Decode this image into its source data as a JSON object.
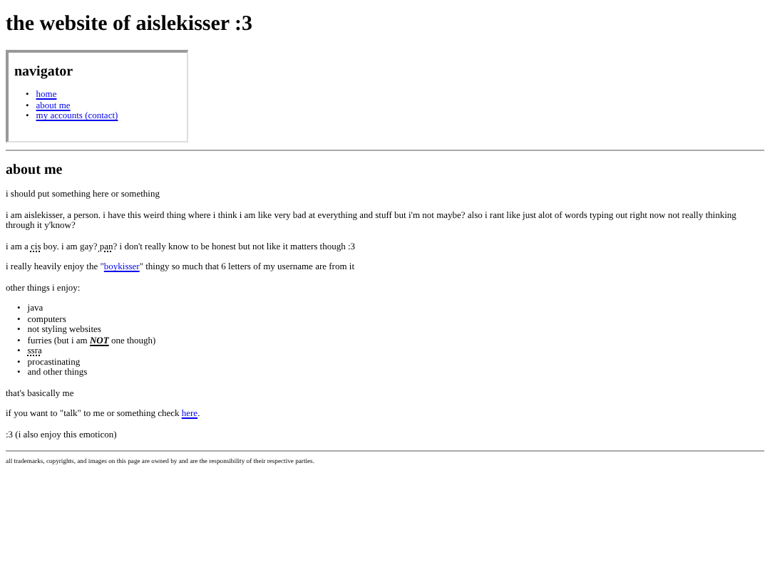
{
  "title": "the website of aislekisser :3",
  "navigator": {
    "heading": "navigator",
    "bullet": "•",
    "links": [
      "home",
      "about me",
      "my accounts (contact)"
    ]
  },
  "about": {
    "heading": "about me",
    "bullet": "•",
    "paragraphs": [
      [
        {
          "kind": "text",
          "text": "i should put something here or something"
        }
      ],
      [
        {
          "kind": "text",
          "text": "i am aislekisser, a person. i have this weird thing where i think i am like very bad at everything and stuff but i'm not maybe? also i rant like just alot of words typing out right now not really thinking through it y'know?"
        }
      ],
      [
        {
          "kind": "text",
          "text": "i am a "
        },
        {
          "kind": "abbr",
          "text": "cis"
        },
        {
          "kind": "text",
          "text": " boy. i am gay? "
        },
        {
          "kind": "abbr",
          "text": "pan"
        },
        {
          "kind": "text",
          "text": "? i don't really know to be honest but not like it matters though :3"
        }
      ],
      [
        {
          "kind": "text",
          "text": "i really heavily enjoy the \""
        },
        {
          "kind": "link",
          "text": "boykisser"
        },
        {
          "kind": "text",
          "text": "\" thingy so much that 6 letters of my username are from it"
        }
      ],
      [
        {
          "kind": "text",
          "text": "other things i enjoy:"
        }
      ]
    ],
    "enjoy": [
      [
        {
          "kind": "text",
          "text": "java"
        }
      ],
      [
        {
          "kind": "text",
          "text": "computers"
        }
      ],
      [
        {
          "kind": "text",
          "text": "not styling websites"
        }
      ],
      [
        {
          "kind": "text",
          "text": "furries (but i am "
        },
        {
          "kind": "strong",
          "text": "NOT"
        },
        {
          "kind": "text",
          "text": " one though)"
        }
      ],
      [
        {
          "kind": "abbr",
          "text": "ssra"
        }
      ],
      [
        {
          "kind": "text",
          "text": "procastinating"
        }
      ],
      [
        {
          "kind": "text",
          "text": "and other things"
        }
      ]
    ],
    "closing": [
      [
        {
          "kind": "text",
          "text": "that's basically me"
        }
      ],
      [
        {
          "kind": "text",
          "text": "if you want to \"talk\" to me or something check "
        },
        {
          "kind": "link",
          "text": "here"
        },
        {
          "kind": "text",
          "text": "."
        }
      ],
      [
        {
          "kind": "text",
          "text": ":3 (i also enjoy this emoticon)"
        }
      ]
    ]
  },
  "footer": "all trademarks, copyrights, and images on this page are owned by and are the responsibility of their respective parties."
}
